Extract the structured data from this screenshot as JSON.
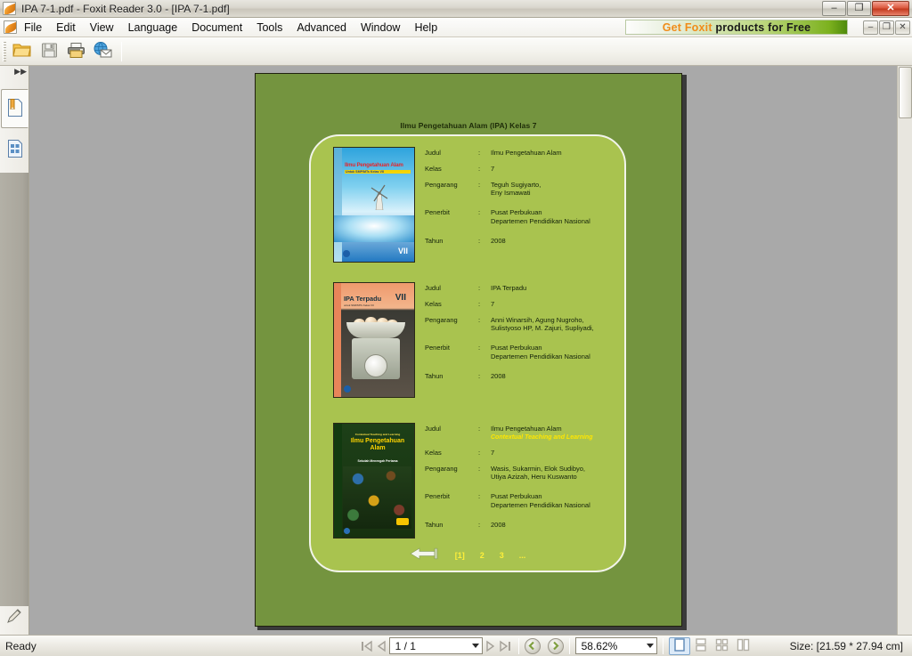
{
  "window": {
    "title": "IPA 7-1.pdf - Foxit Reader 3.0 - [IPA 7-1.pdf]",
    "app_icon": "foxit-icon",
    "minimize_label": "–",
    "maximize_label": "❐",
    "close_label": "✕"
  },
  "menubar": {
    "items": [
      {
        "label": "File"
      },
      {
        "label": "Edit"
      },
      {
        "label": "View"
      },
      {
        "label": "Language"
      },
      {
        "label": "Document"
      },
      {
        "label": "Tools"
      },
      {
        "label": "Advanced"
      },
      {
        "label": "Window"
      },
      {
        "label": "Help"
      }
    ],
    "promo": {
      "part1": "Get Foxit",
      "part2": "products for Free"
    },
    "mdi": {
      "minimize": "–",
      "restore": "❐",
      "close": "✕"
    }
  },
  "toolbar": {
    "buttons": [
      {
        "name": "open-file-button",
        "icon": "open-folder-icon",
        "tooltip": "Open"
      },
      {
        "name": "save-button",
        "icon": "floppy-disk-icon",
        "tooltip": "Save"
      },
      {
        "name": "print-button",
        "icon": "printer-icon",
        "tooltip": "Print"
      },
      {
        "name": "email-button",
        "icon": "globe-envelope-icon",
        "tooltip": "Email"
      }
    ]
  },
  "sidebar": {
    "collapse_icon": "double-chevron-right-icon",
    "tabs": [
      {
        "name": "bookmarks-tab",
        "icon": "bookmark-page-icon",
        "active": true
      },
      {
        "name": "pages-tab",
        "icon": "thumbnail-grid-icon",
        "active": false
      },
      {
        "name": "layers-tab",
        "icon": "layers-diamond-icon",
        "active": false
      }
    ],
    "bottom_tool": {
      "name": "signature-tool",
      "icon": "pen-icon"
    }
  },
  "document": {
    "page_title": "Ilmu Pengetahuan Alam (IPA) Kelas 7",
    "field_labels": {
      "judul": "Judul",
      "kelas": "Kelas",
      "pengarang": "Pengarang",
      "penerbit": "Penerbit",
      "tahun": "Tahun"
    },
    "colon": ":",
    "books": [
      {
        "cover": "book-cover-ilmu-pengetahuan-alam",
        "cover_title": "Ilmu Pengetahuan Alam",
        "cover_subtitle": "Untuk SMP/MTs Kelas VII",
        "cover_grade": "VII",
        "judul": "Ilmu Pengetahuan Alam",
        "subtitle": "",
        "kelas": "7",
        "pengarang_line1": "Teguh Sugiyarto,",
        "pengarang_line2": "Eny Ismawati",
        "penerbit_line1": "Pusat Perbukuan",
        "penerbit_line2": "Departemen Pendidikan Nasional",
        "tahun": "2008"
      },
      {
        "cover": "book-cover-ipa-terpadu",
        "cover_title": "IPA Terpadu",
        "cover_subtitle": "untuk SMP/MTs Kelas VII",
        "cover_grade": "VII",
        "judul": "IPA Terpadu",
        "subtitle": "",
        "kelas": "7",
        "pengarang_line1": "Anni Winarsih, Agung Nugroho,",
        "pengarang_line2": "Sulistyoso HP, M. Zajuri, Supliyadi,",
        "penerbit_line1": "Pusat Perbukuan",
        "penerbit_line2": "Departemen Pendidikan Nasional",
        "tahun": "2008"
      },
      {
        "cover": "book-cover-ipa-ctl",
        "cover_ctl": "Contextual Teaching and Learning",
        "cover_title": "Ilmu Pengetahuan Alam",
        "cover_subtitle": "Sekolah Menengah Pertama",
        "cover_grade": "",
        "judul": "Ilmu Pengetahuan Alam",
        "subtitle": "Contextual Teaching and Learning",
        "kelas": "7",
        "pengarang_line1": "Wasis, Sukarmin, Elok Sudibyo,",
        "pengarang_line2": "Utiya Azizah, Heru Kuswanto",
        "penerbit_line1": "Pusat Perbukuan",
        "penerbit_line2": "Departemen Pendidikan Nasional",
        "tahun": "2008"
      }
    ],
    "pager": {
      "back_icon": "left-arrow-icon",
      "links": [
        "[1]",
        "2",
        "3",
        "..."
      ]
    },
    "colors": {
      "page_background": "#74943f",
      "panel_background": "#a9c34f",
      "panel_border": "#f2f4ea",
      "text": "#12210a",
      "link": "#ffef3a",
      "subtitle": "#ffe600"
    }
  },
  "statusbar": {
    "status": "Ready",
    "first_page_icon": "first-page-icon",
    "prev_page_icon": "previous-page-icon",
    "page_value": "1 / 1",
    "next_page_icon": "next-page-icon",
    "last_page_icon": "last-page-icon",
    "back_icon": "navigate-back-icon",
    "forward_icon": "navigate-forward-icon",
    "zoom_value": "58.62%",
    "layouts": [
      {
        "name": "single-page-layout-button",
        "icon": "single-page-icon",
        "active": true
      },
      {
        "name": "continuous-layout-button",
        "icon": "continuous-page-icon",
        "active": false
      },
      {
        "name": "facing-layout-button",
        "icon": "four-page-icon",
        "active": false
      },
      {
        "name": "continuous-facing-layout-button",
        "icon": "two-page-icon",
        "active": false
      }
    ],
    "size_text": "Size: [21.59 * 27.94 cm]"
  }
}
